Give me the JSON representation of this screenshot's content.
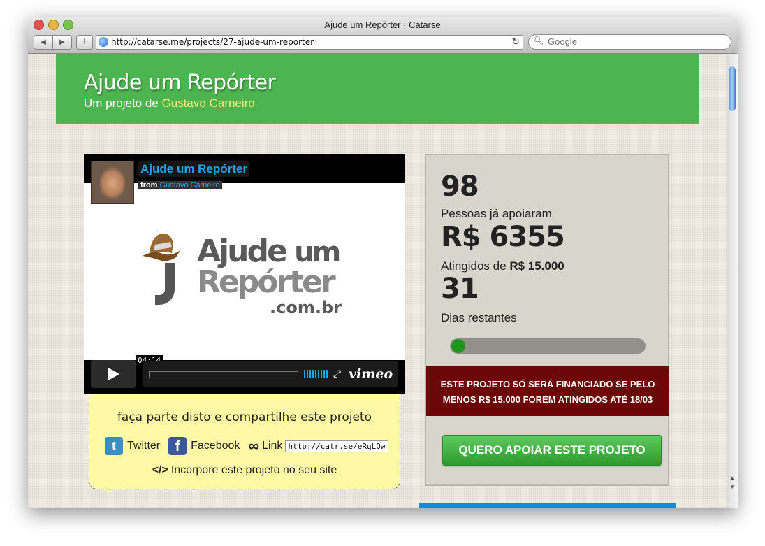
{
  "window": {
    "title": "Ajude um Repórter · Catarse",
    "url": "http://catarse.me/projects/27-ajude-um-reporter",
    "search_placeholder": "Google",
    "back": "◀",
    "forward": "▶",
    "add": "+",
    "reload": "↻"
  },
  "project": {
    "title": "Ajude um Repórter",
    "subtitle_prefix": "Um projeto de",
    "author": "Gustavo Carneiro"
  },
  "video": {
    "title": "Ajude um Repórter",
    "from_label": "from",
    "from_user": "Gustavo Carneiro",
    "logo_line1_a": "Ajude",
    "logo_line1_b": "um",
    "logo_line2": "Repórter",
    "logo_line3": ".com.br",
    "time": "04:14",
    "brand": "vimeo"
  },
  "share": {
    "title": "faça parte disto e compartilhe este projeto",
    "twitter_label": "Twitter",
    "facebook_label": "Facebook",
    "link_label": "Link",
    "link_value": "http://catr.se/eRqLOw",
    "embed_code": "</>",
    "embed_label": "Incorpore este projeto no seu site",
    "twitter_glyph": "t",
    "facebook_glyph": "f"
  },
  "stats": {
    "backers": "98",
    "backers_label": "Pessoas já apoiaram",
    "pledged": "R$ 6355",
    "pledged_label_prefix": "Atingidos de",
    "goal": "R$ 15.000",
    "days": "31",
    "days_label": "Dias restantes",
    "progress_fraction": 0.0,
    "warning_line1": "ESTE PROJETO SÓ SERÁ FINANCIADO SE PELO",
    "warning_line2": "MENOS R$ 15.000 FOREM ATINGIDOS ATÉ 18/03",
    "support_button": "QUERO APOIAR ESTE PROJETO"
  },
  "colors": {
    "header_green": "#4cb550",
    "author_yellow": "#ffe97a",
    "vimeo_blue": "#18a6e8",
    "warning_red": "#6d0606",
    "button_green": "#2d9a2e",
    "share_yellow": "#fff9a6"
  }
}
